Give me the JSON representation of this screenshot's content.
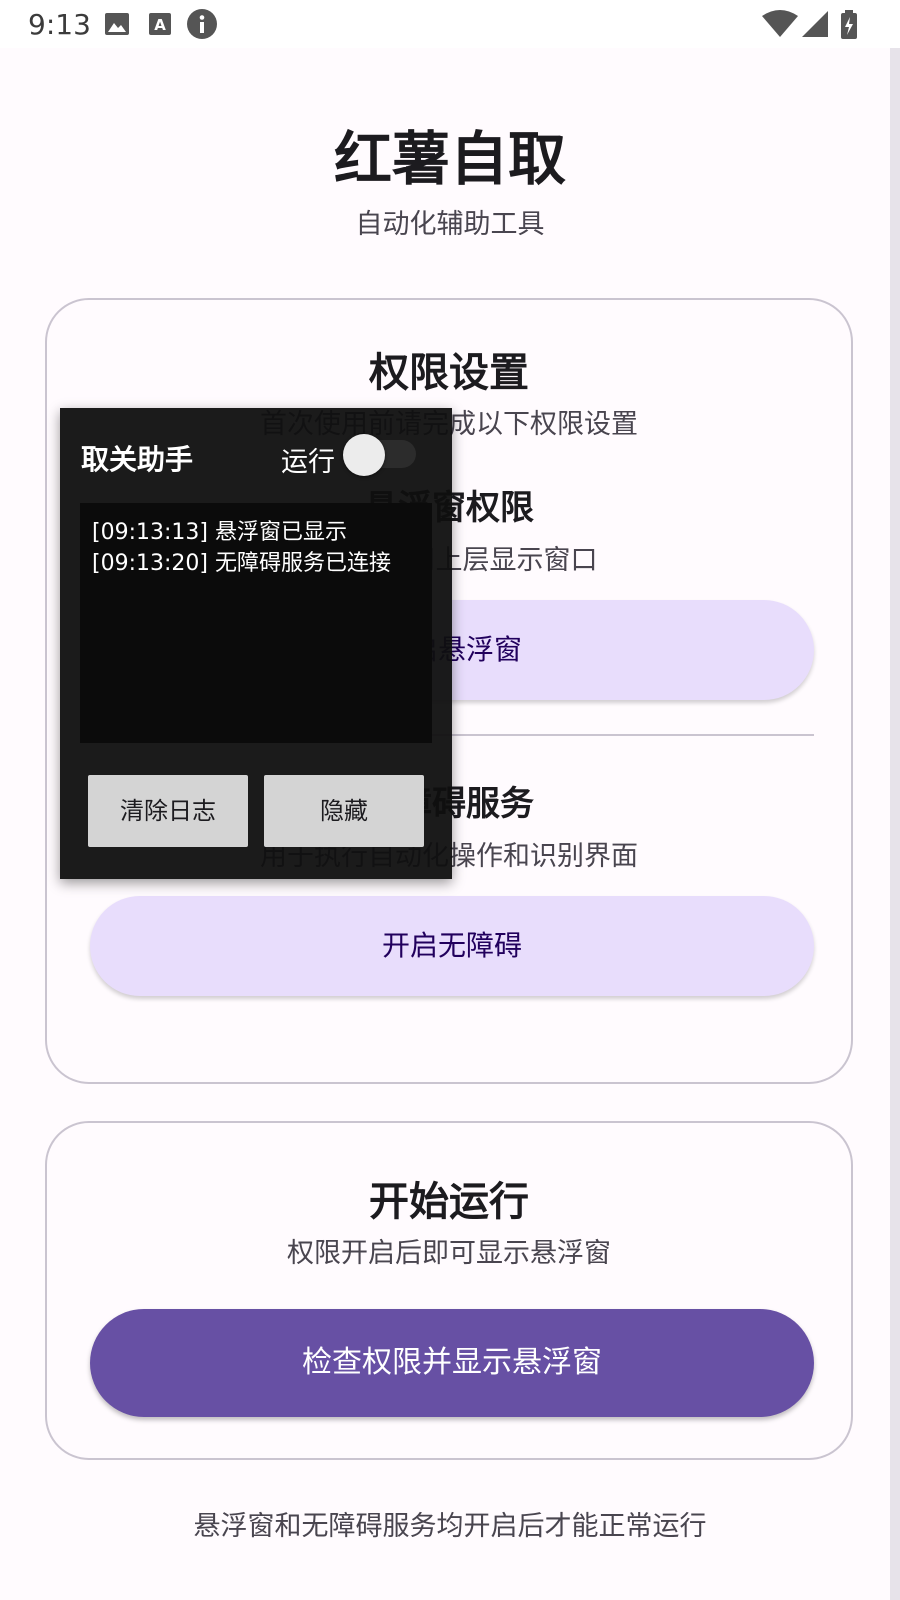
{
  "status_bar": {
    "time": "9:13",
    "left_icons": [
      "image-icon",
      "text-a-icon",
      "info-icon"
    ],
    "right_icons": [
      "wifi-icon",
      "cell-signal-icon",
      "battery-icon"
    ]
  },
  "app": {
    "title": "红薯自取",
    "subtitle": "自动化辅助工具"
  },
  "permission_card": {
    "title": "权限设置",
    "description": "首次使用前请完成以下权限设置",
    "overlay_section": {
      "title": "悬浮窗权限",
      "description": "在其他应用上层显示窗口",
      "button": "开启悬浮窗"
    },
    "accessibility_section": {
      "title": "无障碍服务",
      "description": "用于执行自动化操作和识别界面",
      "button": "开启无障碍"
    }
  },
  "run_card": {
    "title": "开始运行",
    "description": "权限开启后即可显示悬浮窗",
    "button": "检查权限并显示悬浮窗"
  },
  "footer": "悬浮窗和无障碍服务均开启后才能正常运行",
  "floating_window": {
    "title": "取关助手",
    "run_label": "运行",
    "run_switch_on": false,
    "log_lines": [
      "[09:13:13] 悬浮窗已显示",
      "[09:13:20] 无障碍服务已连接"
    ],
    "clear_button": "清除日志",
    "hide_button": "隐藏"
  },
  "colors": {
    "background": "#fffbfe",
    "primary": "#6750a4",
    "tonal_button": "#e8ddfc",
    "tonal_text": "#21005d",
    "overlay_bg": "#0f0f0f"
  }
}
